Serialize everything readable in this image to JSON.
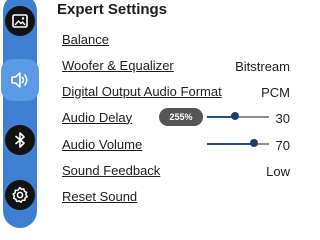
{
  "title": "Expert Settings",
  "sidebar": {
    "items": [
      {
        "icon": "image-icon"
      },
      {
        "icon": "speaker-icon",
        "selected": true
      },
      {
        "icon": "bluetooth-icon"
      },
      {
        "icon": "gear-icon"
      }
    ]
  },
  "settings": {
    "balance": {
      "label": "Balance"
    },
    "woofer": {
      "label": "Woofer & Equalizer",
      "value": "Bitstream"
    },
    "digital_output": {
      "label": "Digital Output Audio Format",
      "value": "PCM"
    },
    "audio_delay": {
      "label": "Audio Delay",
      "value": "30",
      "badge": "255%",
      "level": 0.45
    },
    "audio_volume": {
      "label": "Audio Volume",
      "value": "70",
      "level": 0.75
    },
    "sound_feedback": {
      "label": "Sound Feedback",
      "value": "Low"
    },
    "reset_sound": {
      "label": "Reset Sound"
    }
  },
  "colors": {
    "sidebar": "#3f7fd1",
    "sidebar_selected": "#5b9ae6",
    "slider_thumb": "#1d3f6a",
    "badge": "#555555"
  }
}
